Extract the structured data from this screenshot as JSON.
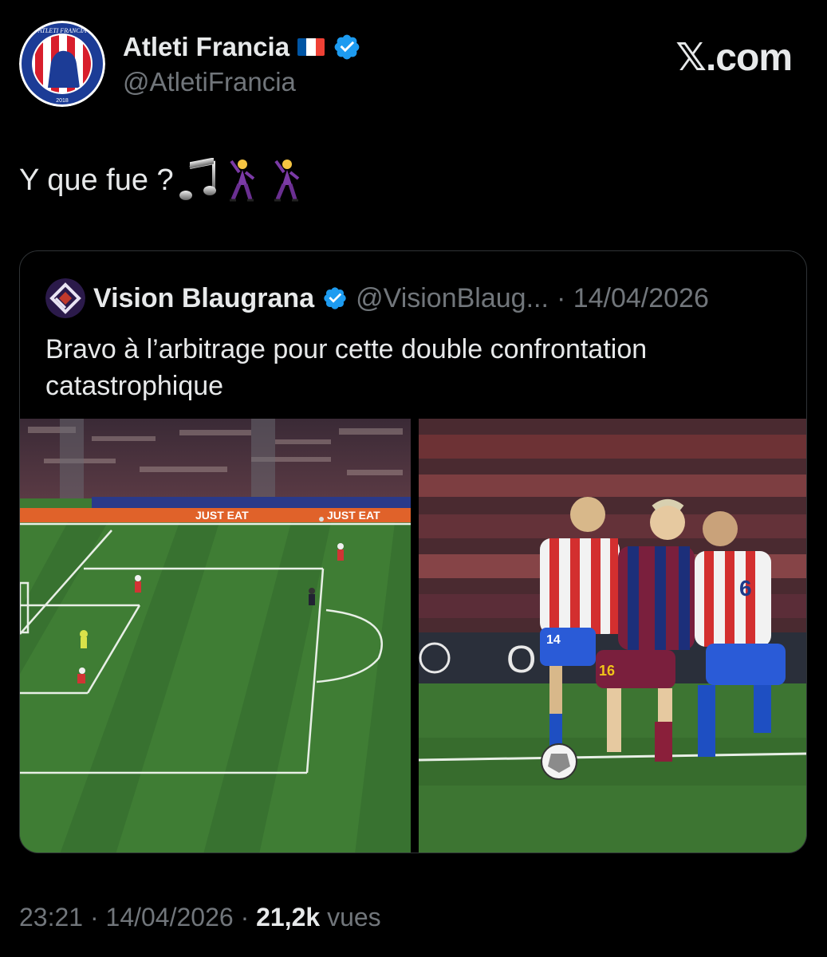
{
  "author": {
    "name": "Atleti Francia",
    "handle": "@AtletiFrancia",
    "avatar_text": "ATLETI FRANCIA",
    "avatar_year": "2018"
  },
  "brand": "𝕏.com",
  "tweet": {
    "text": "Y que fue ?",
    "emojis": [
      "music-notes",
      "dancing-man",
      "dancing-man"
    ]
  },
  "quoted": {
    "name": "Vision Blaugrana",
    "handle": "@VisionBlaug...",
    "date": "· 14/04/2026",
    "text": "Bravo à l’arbitrage pour cette double confrontation catastrophique",
    "banner_text": "JUST EAT",
    "shirt_numbers": [
      "14",
      "16",
      "6"
    ]
  },
  "footer": {
    "time": "23:21",
    "date": "14/04/2026",
    "views": "21,2k",
    "views_label": "vues"
  },
  "colors": {
    "background": "#000000",
    "verified": "#1d9bf0",
    "muted": "#71767b",
    "text": "#e7e9ea"
  }
}
